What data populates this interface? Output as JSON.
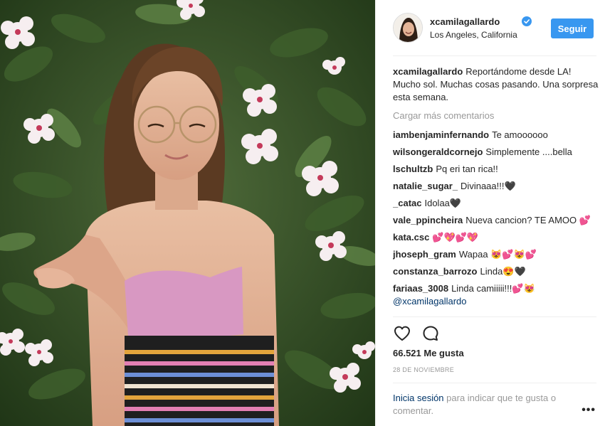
{
  "post": {
    "photo_icon": "portrait-photo"
  },
  "header": {
    "username": "xcamilagallardo",
    "location": "Los Angeles, California",
    "follow_label": "Seguir",
    "verified_icon": "verified-badge",
    "avatar_icon": "profile-avatar"
  },
  "caption": {
    "username": "xcamilagallardo",
    "text": "Reportándome desde LA! Mucho sol. Muchas cosas pasando. Una sorpresa esta semana."
  },
  "load_more": "Cargar más comentarios",
  "comments": [
    {
      "user": "iambenjaminfernando",
      "text": "Te amoooooo"
    },
    {
      "user": "wilsongeraldcornejo",
      "text": "Simplemente ....bella"
    },
    {
      "user": "lschultzb",
      "text": "Pq eri tan rica!!"
    },
    {
      "user": "natalie_sugar_",
      "text": "Divinaaa!!!🖤"
    },
    {
      "user": "_catac",
      "text": "Idolaa🖤"
    },
    {
      "user": "vale_ppincheira",
      "text": "Nueva cancion? TE AMOO 💕"
    },
    {
      "user": "kata.csc",
      "text": "💕💖💕💖"
    },
    {
      "user": "jhoseph_gram",
      "text": "Wapaa 😻💕😻💕"
    },
    {
      "user": "constanza_barrozo",
      "text": "Linda😍🖤"
    },
    {
      "user": "fariaas_3008",
      "text": "Linda camiiiii!!!💕😻"
    }
  ],
  "mention": "@xcamilagallardo",
  "actions": {
    "like_icon": "heart-icon",
    "comment_icon": "comment-bubble-icon"
  },
  "likes": "66.521 Me gusta",
  "date": "28 DE NOVIEMBRE",
  "login": {
    "link": "Inicia sesión",
    "rest": " para indicar que te gusta o comentar."
  },
  "more_label": "•••",
  "colors": {
    "accent": "#3897f0",
    "link": "#003569",
    "muted": "#999999",
    "text": "#262626"
  }
}
